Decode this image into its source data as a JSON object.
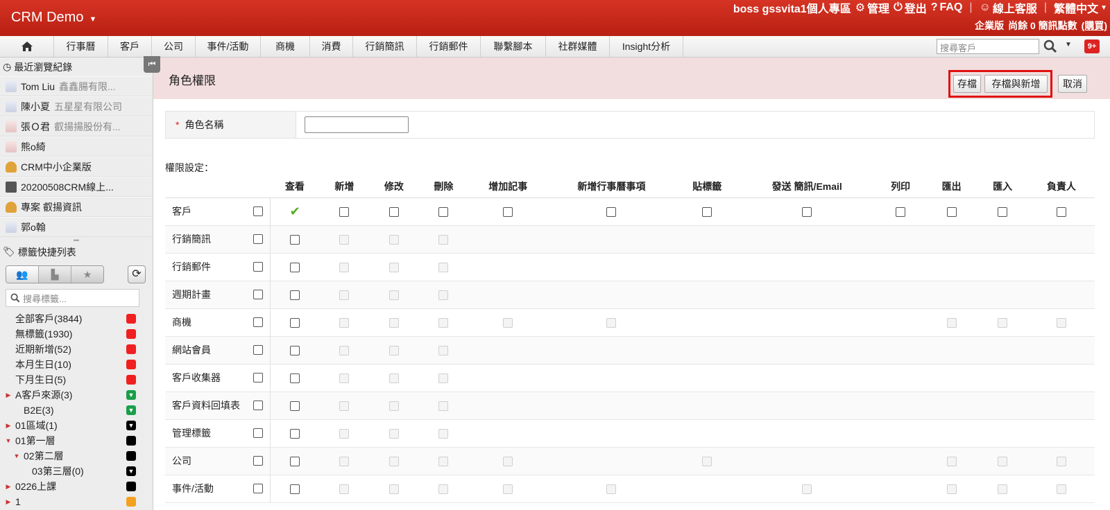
{
  "app": {
    "brand": "CRM Demo",
    "top_links": [
      "boss gssvita1個人專區",
      "管理",
      "登出",
      "FAQ",
      "線上客服",
      "繁體中文"
    ],
    "edition": "企業版",
    "sms_balance": "尚餘 0 簡訊點數",
    "buy_link": "(購買)",
    "notification_count": "9+"
  },
  "menu": {
    "items": [
      "行事曆",
      "客戶",
      "公司",
      "事件/活動",
      "商機",
      "消費",
      "行銷簡訊",
      "行銷郵件",
      "聯繫腳本",
      "社群媒體",
      "Insight分析"
    ],
    "search_placeholder": "搜尋客戶"
  },
  "sidebar": {
    "recent_title": "最近瀏覽紀錄",
    "recent": [
      {
        "name": "Tom Liu",
        "sub": "鑫鑫腸有限...",
        "avatar": "person"
      },
      {
        "name": "陳小夏",
        "sub": "五星星有限公司",
        "avatar": "person"
      },
      {
        "name": "張Ｏ君",
        "sub": "叡揚揚股份有...",
        "avatar": "female"
      },
      {
        "name": "熊o綺",
        "sub": "",
        "avatar": "female"
      },
      {
        "name": "CRM中小企業版",
        "sub": "",
        "avatar": "bag"
      },
      {
        "name": "20200508CRM線上...",
        "sub": "",
        "avatar": "case"
      },
      {
        "name": "專案 叡揚資訊",
        "sub": "",
        "avatar": "bag"
      },
      {
        "name": "郭o翰",
        "sub": "",
        "avatar": "person"
      }
    ],
    "tags_title": "標籤快捷列表",
    "tag_search_placeholder": "搜尋標籤...",
    "tags": [
      {
        "label": "全部客戶(3844)",
        "color": "red",
        "indent": 0,
        "arrow": ""
      },
      {
        "label": "無標籤(1930)",
        "color": "red",
        "indent": 0,
        "arrow": ""
      },
      {
        "label": "近期新增(52)",
        "color": "red",
        "indent": 0,
        "arrow": ""
      },
      {
        "label": "本月生日(10)",
        "color": "red",
        "indent": 0,
        "arrow": ""
      },
      {
        "label": "下月生日(5)",
        "color": "red",
        "indent": 0,
        "arrow": ""
      },
      {
        "label": "A客戶來源(3)",
        "color": "green",
        "indent": 0,
        "arrow": "right"
      },
      {
        "label": "B2E(3)",
        "color": "green",
        "indent": 1,
        "arrow": ""
      },
      {
        "label": "01區域(1)",
        "color": "blackv",
        "indent": 0,
        "arrow": "right"
      },
      {
        "label": "01第一層",
        "color": "black",
        "indent": 0,
        "arrow": "down"
      },
      {
        "label": "02第二層",
        "color": "black",
        "indent": 1,
        "arrow": "down"
      },
      {
        "label": "03第三層(0)",
        "color": "blackv",
        "indent": 2,
        "arrow": ""
      },
      {
        "label": "0226上課",
        "color": "black",
        "indent": 0,
        "arrow": "right"
      },
      {
        "label": "1",
        "color": "orange",
        "indent": 0,
        "arrow": "right"
      }
    ]
  },
  "main": {
    "title": "角色權限",
    "save": "存檔",
    "save_new": "存檔與新增",
    "cancel": "取消",
    "role_name_label": "角色名稱",
    "role_name_value": "",
    "perm_title": "權限設定：",
    "columns": [
      "查看",
      "新增",
      "修改",
      "刪除",
      "增加記事",
      "新增行事曆事項",
      "貼標籤",
      "發送 簡訊/Email",
      "列印",
      "匯出",
      "匯入",
      "負責人"
    ],
    "rows": [
      {
        "name": "客戶",
        "cells": [
          "check",
          "cb",
          "cb",
          "cb",
          "cb",
          "cb",
          "cb",
          "cb",
          "cb",
          "cb",
          "cb",
          "cb"
        ]
      },
      {
        "name": "行銷簡訊",
        "cells": [
          "cb",
          "dis",
          "dis",
          "dis",
          "",
          "",
          "",
          "",
          "",
          "",
          "",
          ""
        ]
      },
      {
        "name": "行銷郵件",
        "cells": [
          "cb",
          "dis",
          "dis",
          "dis",
          "",
          "",
          "",
          "",
          "",
          "",
          "",
          ""
        ]
      },
      {
        "name": "週期計畫",
        "cells": [
          "cb",
          "dis",
          "dis",
          "dis",
          "",
          "",
          "",
          "",
          "",
          "",
          "",
          ""
        ]
      },
      {
        "name": "商機",
        "cells": [
          "cb",
          "dis",
          "dis",
          "dis",
          "dis",
          "dis",
          "",
          "",
          "",
          "dis",
          "dis",
          "dis"
        ]
      },
      {
        "name": "網站會員",
        "cells": [
          "cb",
          "dis",
          "dis",
          "dis",
          "",
          "",
          "",
          "",
          "",
          "",
          "",
          ""
        ]
      },
      {
        "name": "客戶收集器",
        "cells": [
          "cb",
          "dis",
          "dis",
          "dis",
          "",
          "",
          "",
          "",
          "",
          "",
          "",
          ""
        ]
      },
      {
        "name": "客戶資料回填表",
        "cells": [
          "cb",
          "dis",
          "dis",
          "dis",
          "",
          "",
          "",
          "",
          "",
          "",
          "",
          ""
        ]
      },
      {
        "name": "管理標籤",
        "cells": [
          "cb",
          "dis",
          "dis",
          "dis",
          "",
          "",
          "",
          "",
          "",
          "",
          "",
          ""
        ]
      },
      {
        "name": "公司",
        "cells": [
          "cb",
          "dis",
          "dis",
          "dis",
          "dis",
          "",
          "dis",
          "",
          "",
          "dis",
          "dis",
          "dis"
        ]
      },
      {
        "name": "事件/活動",
        "cells": [
          "cb",
          "dis",
          "dis",
          "dis",
          "dis",
          "dis",
          "",
          "dis",
          "",
          "dis",
          "dis",
          "dis"
        ]
      }
    ]
  }
}
